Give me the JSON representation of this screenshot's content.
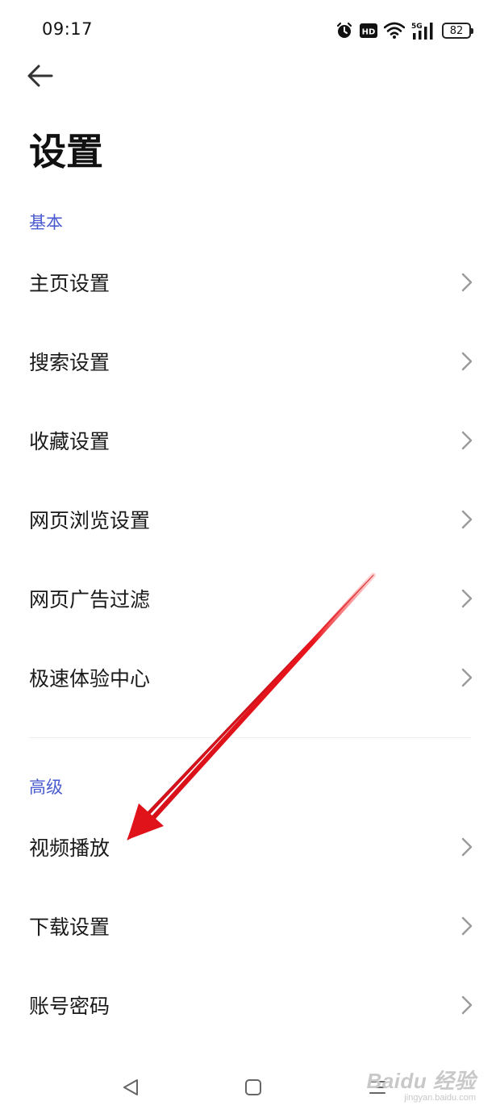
{
  "status_bar": {
    "time": "09:17",
    "hd_label": "HD",
    "network_label": "5G",
    "battery": "82"
  },
  "header": {
    "title": "设置"
  },
  "sections": [
    {
      "header": "基本",
      "items": [
        {
          "label": "主页设置"
        },
        {
          "label": "搜索设置"
        },
        {
          "label": "收藏设置"
        },
        {
          "label": "网页浏览设置"
        },
        {
          "label": "网页广告过滤"
        },
        {
          "label": "极速体验中心"
        }
      ]
    },
    {
      "header": "高级",
      "items": [
        {
          "label": "视频播放"
        },
        {
          "label": "下载设置"
        },
        {
          "label": "账号密码"
        }
      ]
    }
  ],
  "watermark": {
    "brand": "Baidu 经验",
    "url": "jingyan.baidu.com"
  },
  "colors": {
    "accent": "#4a5bd0",
    "annotation_arrow": "#e8141b"
  }
}
